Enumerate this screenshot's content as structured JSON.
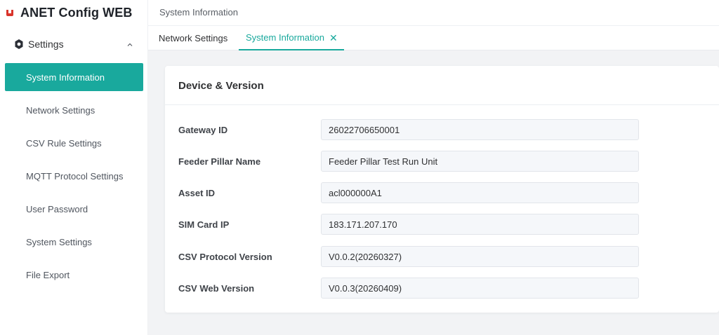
{
  "app": {
    "title": "ANET Config WEB"
  },
  "sidebar": {
    "group_label": "Settings",
    "items": [
      {
        "label": "System Information",
        "active": true
      },
      {
        "label": "Network Settings",
        "active": false
      },
      {
        "label": "CSV Rule Settings",
        "active": false
      },
      {
        "label": "MQTT Protocol Settings",
        "active": false
      },
      {
        "label": "User Password",
        "active": false
      },
      {
        "label": "System Settings",
        "active": false
      },
      {
        "label": "File Export",
        "active": false
      }
    ]
  },
  "header": {
    "breadcrumb": "System Information"
  },
  "tabs": [
    {
      "label": "Network Settings",
      "active": false
    },
    {
      "label": "System Information",
      "active": true
    }
  ],
  "card": {
    "title": "Device & Version",
    "fields": [
      {
        "label": "Gateway ID",
        "value": "26022706650001"
      },
      {
        "label": "Feeder Pillar Name",
        "value": "Feeder Pillar Test Run Unit"
      },
      {
        "label": "Asset ID",
        "value": "acl000000A1"
      },
      {
        "label": "SIM Card IP",
        "value": "183.171.207.170"
      },
      {
        "label": "CSV Protocol Version",
        "value": "V0.0.2(20260327)"
      },
      {
        "label": "CSV Web Version",
        "value": "V0.0.3(20260409)"
      }
    ]
  },
  "colors": {
    "accent": "#19a99d",
    "brand_logo": "#d9342b",
    "main_bg": "#f2f3f5"
  },
  "icons": {
    "brand": "anet-logo-icon",
    "settings": "gear-icon",
    "collapse": "chevron-up-icon",
    "tab_close": "close-icon"
  }
}
